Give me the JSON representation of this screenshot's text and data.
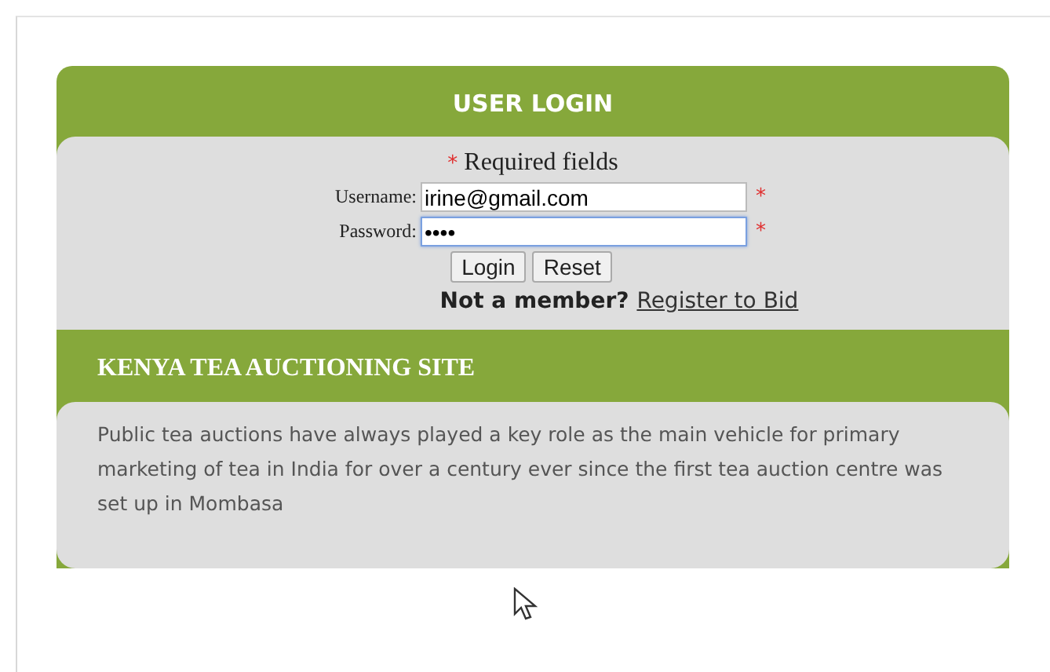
{
  "login": {
    "title": "USER LOGIN",
    "required_note": {
      "mark": "*",
      "text": "Required fields"
    },
    "fields": [
      {
        "label": "Username:",
        "value": "irine@gmail.com",
        "required_mark": "*",
        "focused": false
      },
      {
        "label": "Password:",
        "value": "••••",
        "required_mark": "*",
        "focused": true
      }
    ],
    "buttons": [
      "Login",
      "Reset"
    ],
    "member_prompt": "Not a member?",
    "register_link": "Register to Bid"
  },
  "about": {
    "title": "KENYA TEA AUCTIONING SITE",
    "text": "Public tea auctions have always played a key role as the main vehicle for primary marketing of tea in India for over a century ever since the first tea auction centre was set up in Mombasa"
  }
}
